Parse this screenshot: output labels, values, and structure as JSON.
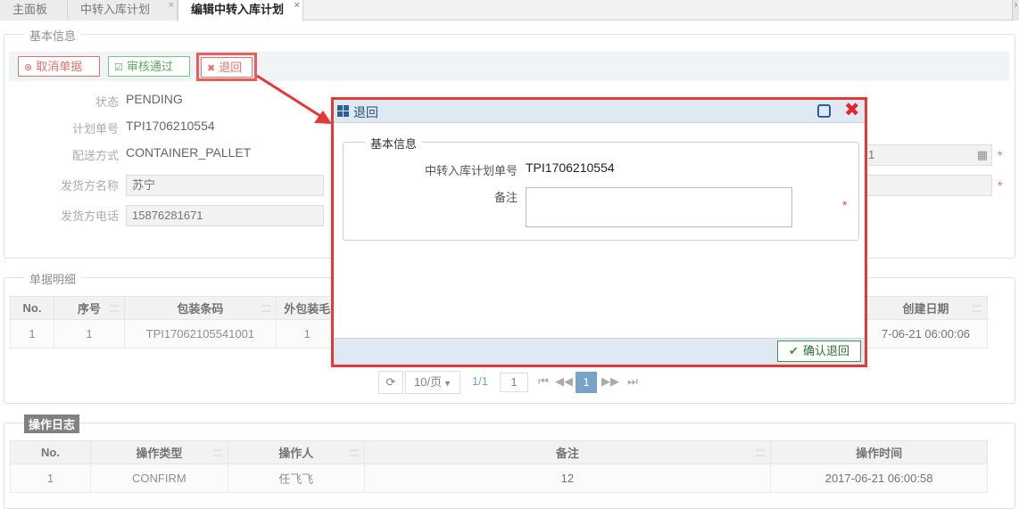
{
  "tabs": [
    {
      "label": "主面板",
      "closable": false,
      "active": false
    },
    {
      "label": "中转入库计划",
      "closable": true,
      "active": false
    },
    {
      "label": "编辑中转入库计划",
      "closable": true,
      "active": true
    }
  ],
  "basic_info": {
    "legend": "基本信息",
    "toolbar": {
      "cancel": "取消单据",
      "approve": "审核通过",
      "return": "退回"
    },
    "status_label": "状态",
    "status_value": "PENDING",
    "plan_no_label": "计划单号",
    "plan_no_value": "TPI1706210554",
    "delivery_label": "配送方式",
    "delivery_value": "CONTAINER_PALLET",
    "sender_name_label": "发货方名称",
    "sender_name_value": "苏宁",
    "sender_phone_label": "发货方电话",
    "sender_phone_value": "15876281671",
    "date_partial_value": "1"
  },
  "details": {
    "legend": "单据明细",
    "columns": [
      "No.",
      "序号",
      "包装条码",
      "外包装毛",
      "创建日期"
    ],
    "rows": [
      {
        "no": "1",
        "seq": "1",
        "barcode": "TPI17062105541001",
        "outer": "1",
        "created": "7-06-21 06:00:06"
      }
    ],
    "pager": {
      "page_size": "10/页",
      "page_info": "1/1",
      "page_input": "1",
      "current": "1"
    }
  },
  "log": {
    "legend": "操作日志",
    "columns": [
      "No.",
      "操作类型",
      "操作人",
      "备注",
      "操作时间"
    ],
    "rows": [
      {
        "no": "1",
        "type": "CONFIRM",
        "operator": "任飞飞",
        "remark": "12",
        "time": "2017-06-21 06:00:58"
      }
    ]
  },
  "dialog": {
    "title": "退回",
    "legend": "基本信息",
    "plan_no_label": "中转入库计划单号",
    "plan_no_value": "TPI1706210554",
    "remark_label": "备注",
    "remark_value": "",
    "confirm_label": "确认退回"
  },
  "colors": {
    "accent_red": "#e53935",
    "approve_green": "#3c963c",
    "title_blue": "#1f4d7a"
  }
}
